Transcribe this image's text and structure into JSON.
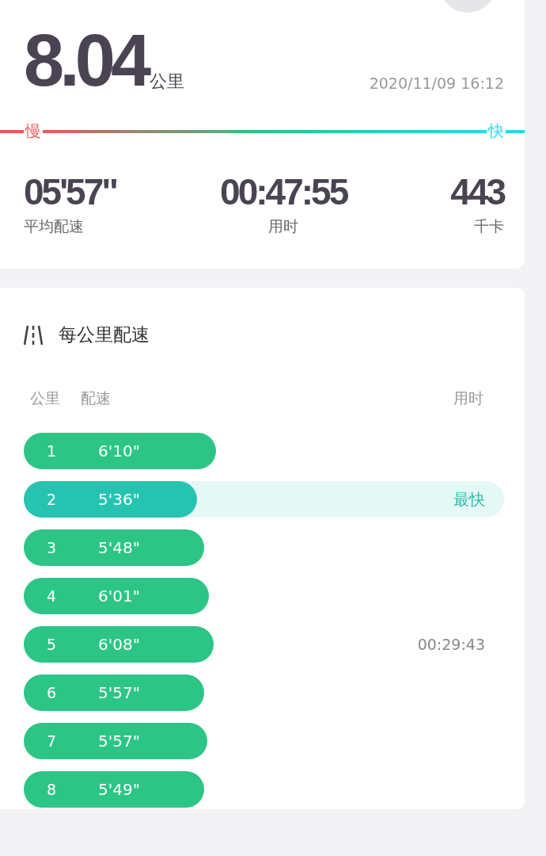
{
  "summary": {
    "distance": "8.04",
    "distance_unit": "公里",
    "datetime": "2020/11/09 16:12",
    "pace_scale": {
      "slow": "慢",
      "fast": "快"
    },
    "stats": [
      {
        "value": "05'57\"",
        "label": "平均配速"
      },
      {
        "value": "00:47:55",
        "label": "用时"
      },
      {
        "value": "443",
        "label": "千卡"
      }
    ]
  },
  "splits": {
    "title": "每公里配速",
    "columns": [
      "公里",
      "配速",
      "用时"
    ],
    "fastest_label": "最快",
    "rows": [
      {
        "km": "1",
        "pace": "6'10\"",
        "selected": false
      },
      {
        "km": "2",
        "pace": "5'36\"",
        "level": 0.36,
        "selected": true
      },
      {
        "km": "3",
        "pace": "5'48\"",
        "selected": false
      },
      {
        "km": "4",
        "pace": "6'01\"",
        "selected": false
      },
      {
        "km": "5",
        "pace": "6'08\"",
        "selected": false,
        "time": "00:29:43"
      },
      {
        "km": "6",
        "pace": "5'57\"",
        "selected": false
      },
      {
        "km": "7",
        "pace": "5'57\"",
        "selected": false
      },
      {
        "km": "8",
        "pace": "5'49\"",
        "selected": false
      }
    ]
  }
}
